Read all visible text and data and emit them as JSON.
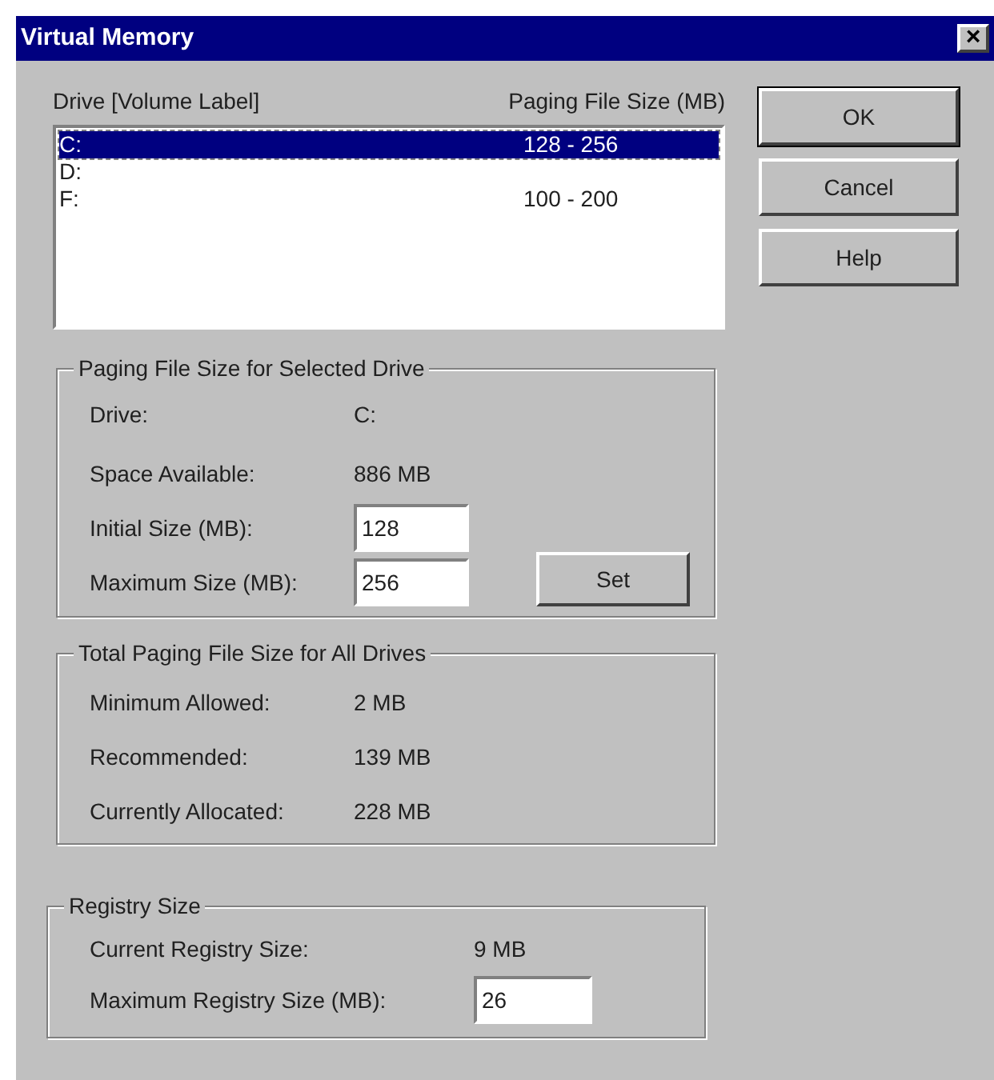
{
  "window": {
    "title": "Virtual Memory",
    "close": "×"
  },
  "drive_list": {
    "column_1": "Drive  [Volume Label]",
    "column_2": "Paging File Size (MB)",
    "rows": [
      {
        "drive": "C:",
        "size": "128 - 256",
        "selected": true
      },
      {
        "drive": "D:",
        "size": "",
        "selected": false
      },
      {
        "drive": "F:",
        "size": "100 - 200",
        "selected": false
      }
    ]
  },
  "buttons": [
    "OK",
    "Cancel",
    "Help"
  ],
  "selected_drive": {
    "title": "Paging File Size for Selected Drive",
    "info": [
      {
        "label": "Drive:",
        "value": "C:"
      },
      {
        "label": "Space Available:",
        "value": "886 MB"
      }
    ],
    "fields": [
      {
        "label": "Initial Size (MB):",
        "value": "128"
      },
      {
        "label": "Maximum Size (MB):",
        "value": "256"
      }
    ],
    "set_button": "Set"
  },
  "totals": {
    "title": "Total Paging File Size for All Drives",
    "info": [
      {
        "label": "Minimum Allowed:",
        "value": "2 MB"
      },
      {
        "label": "Recommended:",
        "value": "139 MB"
      },
      {
        "label": "Currently Allocated:",
        "value": "228 MB"
      }
    ]
  },
  "registry": {
    "title": "Registry Size",
    "current": {
      "label": "Current Registry Size:",
      "value": "9 MB"
    },
    "maximum": {
      "label": "Maximum Registry Size (MB):",
      "value": "26"
    }
  }
}
